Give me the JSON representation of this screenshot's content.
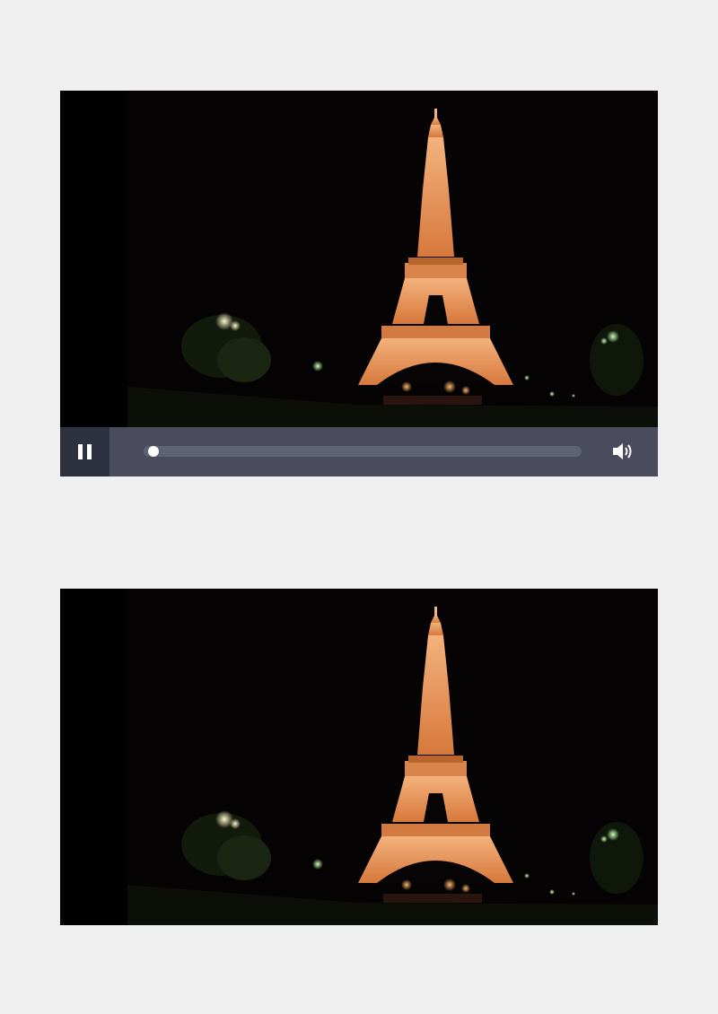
{
  "player": {
    "playback_state": "playing",
    "progress_fraction": 0.01,
    "controls": {
      "pause_icon": "pause-icon",
      "volume_icon": "volume-icon"
    },
    "colors": {
      "control_bar": "#4a4c5d",
      "button_bg": "#2e3140",
      "track": "#5f6275",
      "thumb": "#ffffff"
    }
  },
  "scene": {
    "subject": "eiffel-tower-night",
    "tower_color": "#e8925a",
    "sky_color": "#050304"
  }
}
